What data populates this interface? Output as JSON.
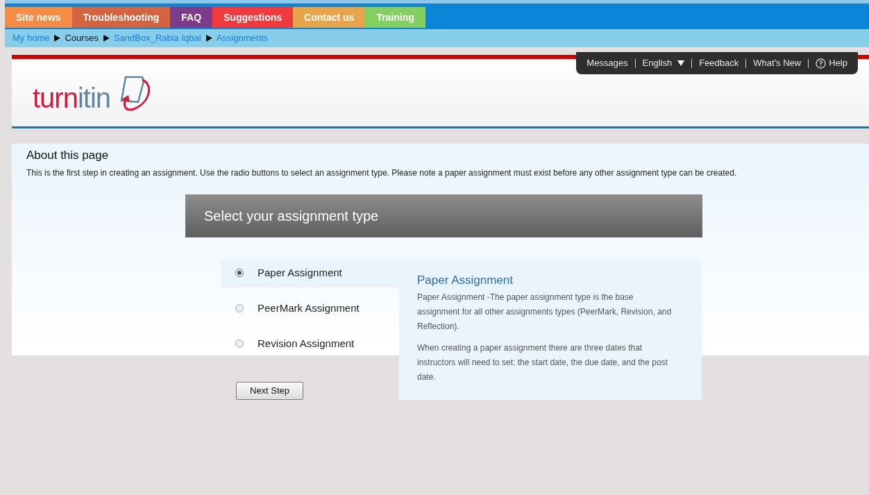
{
  "nav_tabs": [
    {
      "label": "Site news",
      "color": "#f68b45"
    },
    {
      "label": "Troubleshooting",
      "color": "#d4643f"
    },
    {
      "label": "FAQ",
      "color": "#7d3c8a"
    },
    {
      "label": "Suggestions",
      "color": "#f13a3e"
    },
    {
      "label": "Contact us",
      "color": "#e8a44a"
    },
    {
      "label": "Training",
      "color": "#83cf62"
    }
  ],
  "breadcrumbs": [
    {
      "label": "My home",
      "link": true
    },
    {
      "label": "Courses",
      "link": false
    },
    {
      "label": "SandBox_Rabia Iqbal",
      "link": true
    },
    {
      "label": "Assignments",
      "link": true
    }
  ],
  "header": {
    "logo": [
      "turn",
      "itin"
    ],
    "menu": [
      {
        "label": "Messages",
        "kind": "link"
      },
      {
        "label": "English",
        "kind": "dropdown"
      },
      {
        "label": "Feedback",
        "kind": "link"
      },
      {
        "label": "What's New",
        "kind": "link"
      },
      {
        "label": "Help",
        "kind": "help"
      }
    ]
  },
  "about": {
    "title": "About this page",
    "text": "This is the first step in creating an assignment. Use the radio buttons to select an assignment type. Please note a paper assignment must exist before any other assignment type can be created."
  },
  "panel_title": "Select your assignment type",
  "options": [
    {
      "label": "Paper Assignment",
      "selected": true
    },
    {
      "label": "PeerMark Assignment",
      "selected": false
    },
    {
      "label": "Revision Assignment",
      "selected": false
    }
  ],
  "info": {
    "title": "Paper Assignment",
    "paragraphs": [
      "Paper Assignment -The paper assignment type is the base assignment for all other assignments types (PeerMark, Revision, and Reflection).",
      "When creating a paper assignment there are three dates that instructors will need to set: the start date, the due date, and the post date."
    ]
  },
  "next_button": "Next Step"
}
